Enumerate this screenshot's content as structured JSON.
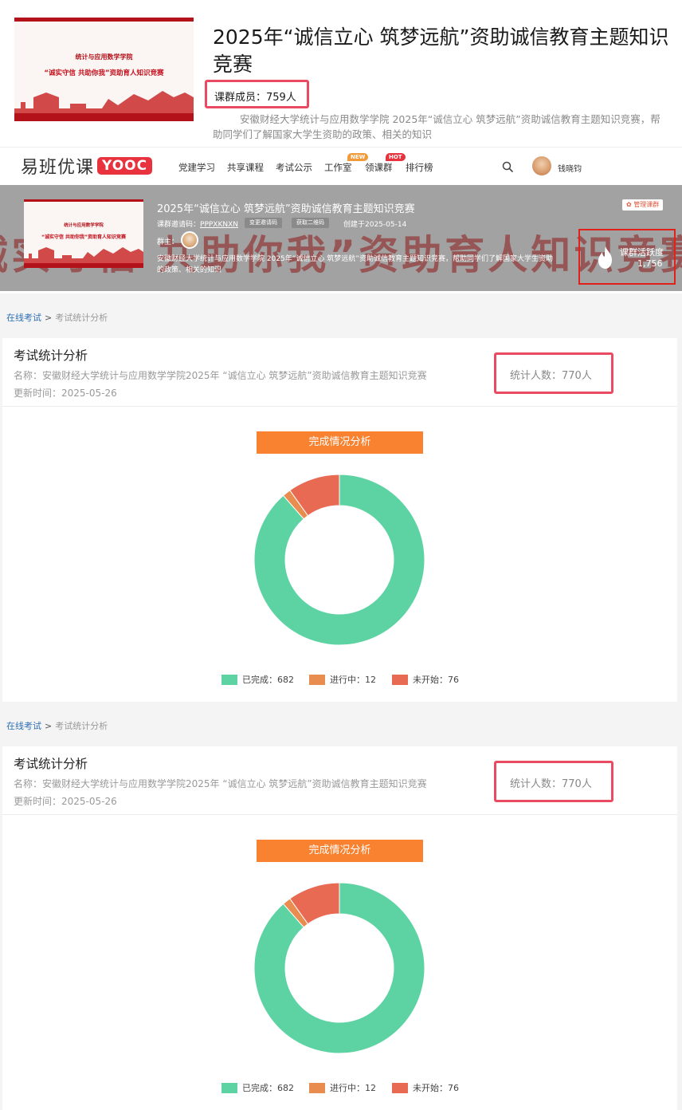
{
  "course": {
    "cover_sub": "统计与应用数学学院",
    "cover_main": "“诚实守信 共助你我”资助育人知识竞赛",
    "title": "2025年“诚信立心 筑梦远航”资助诚信教育主题知识竞赛",
    "members_label": "课群成员：759人",
    "description": "安徽财经大学统计与应用数学学院 2025年“诚信立心 筑梦远航”资助诚信教育主题知识竞赛，帮助同学们了解国家大学生资助的政策、相关的知识"
  },
  "nav": {
    "logo_cn": "易班优课",
    "logo_en": "YOOC",
    "items": [
      {
        "label": "党建学习"
      },
      {
        "label": "共享课程"
      },
      {
        "label": "考试公示"
      },
      {
        "label": "工作室",
        "tag": "NEW"
      },
      {
        "label": "领课群",
        "tag": "HOT"
      },
      {
        "label": "排行榜"
      }
    ],
    "user_name": "钱晓钧",
    "search_icon": "search-icon"
  },
  "hero": {
    "watermark": "诚实守信 共助你我”资助育人知识竞赛",
    "title": "2025年“诚信立心 筑梦远航”资助诚信教育主题知识竞赛",
    "invite_label": "课群邀请码：",
    "invite_code": "PPPXKNXN",
    "change_code_btn": "变更邀请码",
    "qrcode_btn": "获取二维码",
    "created": "创建于2025-05-14",
    "owner_label": "群主：",
    "description": "安徽财经大学统计与应用数学学院 2025年“诚信立心 筑梦远航”资助诚信教育主题知识竞赛，帮助同学们了解国家大学生资助的政策、相关的知识",
    "manage_btn": "管理课群",
    "activity_label": "课群活跃度",
    "activity_value": "1,756"
  },
  "sections": [
    {
      "breadcrumb_link": "在线考试",
      "breadcrumb_sep": ">",
      "breadcrumb_current": "考试统计分析",
      "title": "考试统计分析",
      "name": "名称：安徽财经大学统计与应用数学学院2025年 “诚信立心 筑梦远航”资助诚信教育主题知识竞赛",
      "update_time": "更新时间：2025-05-26",
      "count": "统计人数：770人",
      "chart_title": "完成情况分析"
    },
    {
      "breadcrumb_link": "在线考试",
      "breadcrumb_sep": ">",
      "breadcrumb_current": "考试统计分析",
      "title": "考试统计分析",
      "name": "名称：安徽财经大学统计与应用数学学院2025年 “诚信立心 筑梦远航”资助诚信教育主题知识竞赛",
      "update_time": "更新时间：2025-05-26",
      "count": "统计人数：770人",
      "chart_title": "完成情况分析"
    }
  ],
  "chart_data": [
    {
      "type": "pie",
      "title": "完成情况分析",
      "categories": [
        "已完成",
        "进行中",
        "未开始"
      ],
      "values": [
        682,
        12,
        76
      ],
      "legend_labels": [
        "已完成：682",
        "进行中：12",
        "未开始：76"
      ],
      "colors": [
        "#5dd3a4",
        "#e88c4f",
        "#e86a52"
      ],
      "legend_position": "bottom"
    },
    {
      "type": "pie",
      "title": "完成情况分析",
      "categories": [
        "已完成",
        "进行中",
        "未开始"
      ],
      "values": [
        682,
        12,
        76
      ],
      "legend_labels": [
        "已完成：682",
        "进行中：12",
        "未开始：76"
      ],
      "colors": [
        "#5dd3a4",
        "#e88c4f",
        "#e86a52"
      ],
      "legend_position": "bottom"
    }
  ]
}
